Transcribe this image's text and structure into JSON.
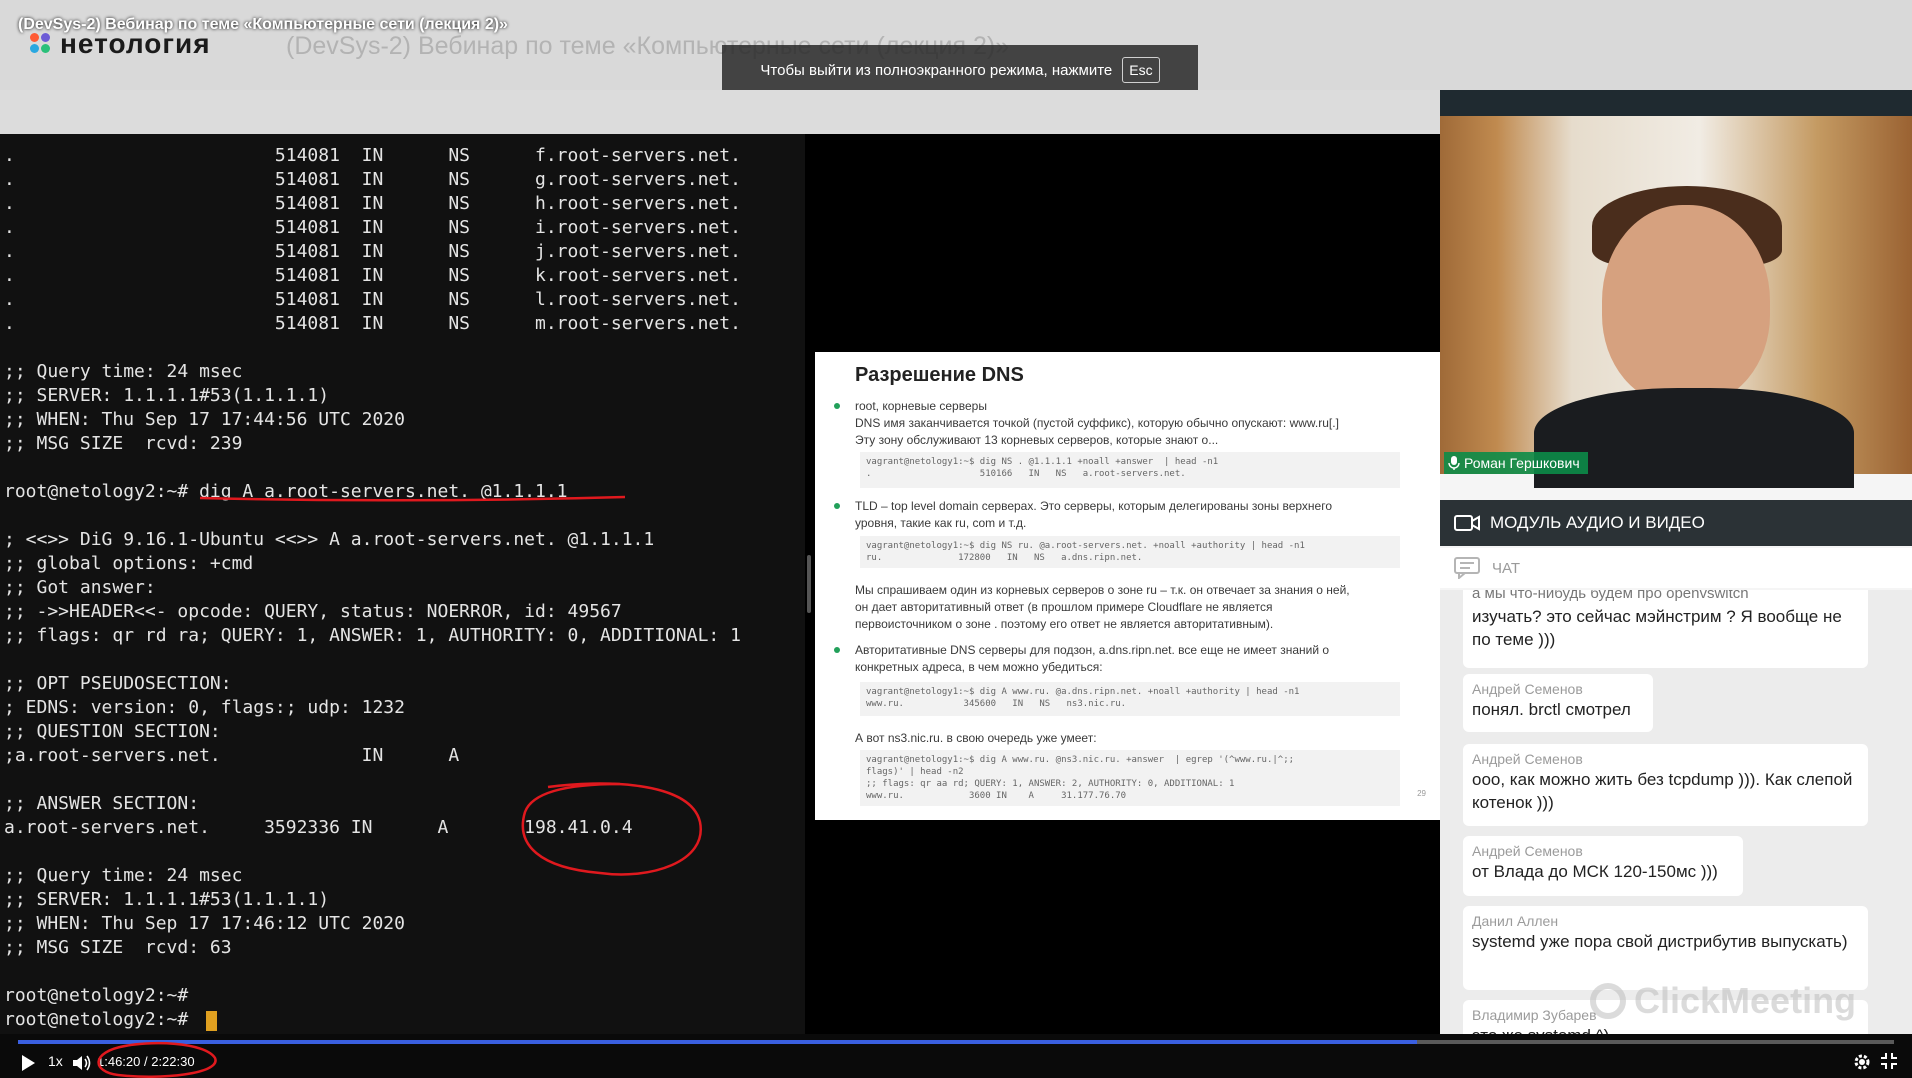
{
  "window": {
    "video_title": "(DevSys-2) Вебинар по теме «Компьютерные сети (лекция 2)»",
    "logo_text": "нетология",
    "background_title": "(DevSys-2) Вебинар по теме «Компьютерные сети (лекция 2)»",
    "fullscreen_toast": "Чтобы выйти из полноэкранного режима, нажмите",
    "fullscreen_key": "Esc"
  },
  "terminal": {
    "lines": [
      ".                        514081  IN      NS      f.root-servers.net.",
      ".                        514081  IN      NS      g.root-servers.net.",
      ".                        514081  IN      NS      h.root-servers.net.",
      ".                        514081  IN      NS      i.root-servers.net.",
      ".                        514081  IN      NS      j.root-servers.net.",
      ".                        514081  IN      NS      k.root-servers.net.",
      ".                        514081  IN      NS      l.root-servers.net.",
      ".                        514081  IN      NS      m.root-servers.net.",
      "",
      ";; Query time: 24 msec",
      ";; SERVER: 1.1.1.1#53(1.1.1.1)",
      ";; WHEN: Thu Sep 17 17:44:56 UTC 2020",
      ";; MSG SIZE  rcvd: 239",
      "",
      "root@netology2:~# dig A a.root-servers.net. @1.1.1.1",
      "",
      "; <<>> DiG 9.16.1-Ubuntu <<>> A a.root-servers.net. @1.1.1.1",
      ";; global options: +cmd",
      ";; Got answer:",
      ";; ->>HEADER<<- opcode: QUERY, status: NOERROR, id: 49567",
      ";; flags: qr rd ra; QUERY: 1, ANSWER: 1, AUTHORITY: 0, ADDITIONAL: 1",
      "",
      ";; OPT PSEUDOSECTION:",
      "; EDNS: version: 0, flags:; udp: 1232",
      ";; QUESTION SECTION:",
      ";a.root-servers.net.             IN      A",
      "",
      ";; ANSWER SECTION:",
      "a.root-servers.net.     3592336 IN      A       198.41.0.4",
      "",
      ";; Query time: 24 msec",
      ";; SERVER: 1.1.1.1#53(1.1.1.1)",
      ";; WHEN: Thu Sep 17 17:46:12 UTC 2020",
      ";; MSG SIZE  rcvd: 63",
      "",
      "root@netology2:~#",
      "root@netology2:~# "
    ]
  },
  "slide": {
    "title": "Разрешение DNS",
    "b1_title": "root, корневые серверы",
    "b1_line1": "DNS имя заканчивается точкой (пустой суффикс), которую обычно опускают: www.ru[.]",
    "b1_line2": "Эту зону обслуживают 13 корневых серверов, которые знают о...",
    "code1": "vagrant@netology1:~$ dig NS . @1.1.1.1 +noall +answer  | head -n1\n.                    510166   IN   NS   a.root-servers.net.",
    "b2_line1": "TLD – top level domain серверах. Это серверы, которым делегированы зоны верхнего",
    "b2_line2": "уровня, такие как ru, com и т.д.",
    "code2": "vagrant@netology1:~$ dig NS ru. @a.root-servers.net. +noall +authority | head -n1\nru.              172800   IN   NS   a.dns.ripn.net.",
    "p_line1": "Мы спрашиваем один из корневых серверов о зоне ru – т.к. он отвечает за знания о ней,",
    "p_line2": "он дает авторитативный ответ (в прошлом примере Cloudflare не является",
    "p_line3": "первоисточником о зоне . поэтому его ответ не является авторитативным).",
    "b3_line1": "Авторитативные DNS серверы для подзон, a.dns.ripn.net. все еще не имеет знаний о",
    "b3_line2": "конкретных адреса, в чем можно убедиться:",
    "code3": "vagrant@netology1:~$ dig A www.ru. @a.dns.ripn.net. +noall +authority | head -n1\nwww.ru.           345600   IN   NS   ns3.nic.ru.",
    "p2": "А вот ns3.nic.ru. в свою очередь уже умеет:",
    "code4": "vagrant@netology1:~$ dig A www.ru. @ns3.nic.ru. +answer  | egrep '(^www.ru.|^;;\nflags)' | head -n2\n;; flags: qr aa rd; QUERY: 1, ANSWER: 2, AUTHORITY: 0, ADDITIONAL: 1\nwww.ru.            3600 IN    A     31.177.76.70",
    "page_num": "29"
  },
  "webcam": {
    "speaker_name": "Роман Гершкович"
  },
  "panels": {
    "av_module": "МОДУЛЬ АУДИО И ВИДЕО",
    "chat": "ЧАТ"
  },
  "chat": {
    "m0_cut": "а мы что-нибудь будем про openvswitch",
    "m0_text": "изучать? это сейчас мэйнстрим ? Я вообще не по теме )))",
    "m1_author": "Андрей Семенов",
    "m1_text": "понял. brctl смотрел",
    "m2_author": "Андрей Семенов",
    "m2_text": "ооо, как можно жить без tcpdump ))). Как слепой котенок )))",
    "m3_author": "Андрей Семенов",
    "m3_text": "от Влада до МСК 120-150мс )))",
    "m4_author": "Данил Аллен",
    "m4_text": "systemd уже пора свой дистрибутив выпускать)",
    "m5_author": "Владимир Зубарев",
    "m5_text": "это же systemd ^)",
    "watermark": "ClickMeeting"
  },
  "player": {
    "speed": "1x",
    "time": "1:46:20 / 2:22:30",
    "progress": 0.746
  },
  "colors": {
    "annotation": "#e0191e",
    "progress": "#3a5fe0",
    "speaker_label": "#0c8c48",
    "cursor": "#e0a020"
  }
}
